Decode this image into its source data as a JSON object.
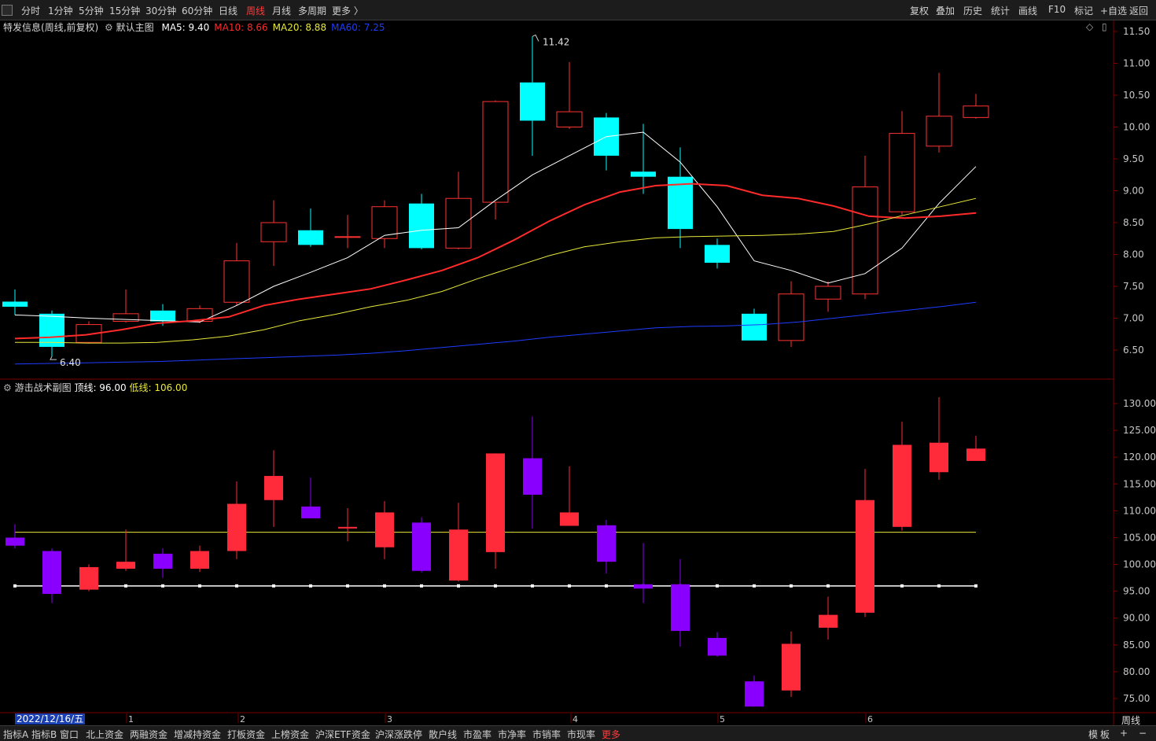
{
  "toolbar": {
    "periods": [
      "分时",
      "1分钟",
      "5分钟",
      "15分钟",
      "30分钟",
      "60分钟",
      "日线",
      "周线",
      "月线",
      "多周期",
      "更多 〉"
    ],
    "active_period": "周线",
    "right_items": [
      "复权",
      "叠加",
      "历史",
      "统计",
      "画线",
      "F10",
      "标记",
      "+自选",
      "返回"
    ]
  },
  "main_panel": {
    "stock_name": "特发信息",
    "period_info": "(周线,前复权)",
    "indicator_name": "默认主图",
    "ma": [
      {
        "label": "MA5: 9.40",
        "color": "#ffffff"
      },
      {
        "label": "MA10: 8.66",
        "color": "#ff2a2a"
      },
      {
        "label": "MA20: 8.88",
        "color": "#e8e83a"
      },
      {
        "label": "MA60: 7.25",
        "color": "#1e3cff"
      }
    ],
    "high_marker": "11.42",
    "low_marker": "6.40",
    "y_ticks": [
      "11.50",
      "11.00",
      "10.50",
      "10.00",
      "9.50",
      "9.00",
      "8.50",
      "8.00",
      "7.50",
      "7.00",
      "6.50"
    ]
  },
  "sub_panel": {
    "indicator_name": "游击战术副图",
    "top_line_label": "顶线: 96.00",
    "low_line_label": "低线: 106.00",
    "y_ticks": [
      "130.00",
      "125.00",
      "120.00",
      "115.00",
      "110.00",
      "105.00",
      "100.00",
      "95.00",
      "90.00",
      "85.00",
      "80.00",
      "75.00"
    ]
  },
  "x_axis": {
    "date_label": "2022/12/16/五",
    "month_labels": [
      "1",
      "2",
      "3",
      "4",
      "5",
      "6"
    ],
    "period_label": "周线"
  },
  "bottom_tabs": [
    "指标A",
    "指标B",
    "窗口",
    "北上资金",
    "两融资金",
    "增减持资金",
    "打板资金",
    "上榜资金",
    "沪深ETF资金",
    "沪深涨跌停",
    "散户线",
    "市盈率",
    "市净率",
    "市销率",
    "市现率",
    "更多"
  ],
  "bottom_active": "更多",
  "bottom_right": [
    "模",
    "板",
    "+",
    "−"
  ],
  "colors": {
    "up": "#ff3232",
    "down": "#00ffff",
    "sub_up": "#ff2a3a",
    "sub_down": "#8a00ff",
    "grid": "#7a0000"
  },
  "chart_data": [
    {
      "type": "candlestick",
      "title": "特发信息 (周线,前复权)",
      "ylim": [
        6.2,
        11.6
      ],
      "candles": [
        {
          "o": 7.26,
          "c": 7.18,
          "h": 7.45,
          "l": 7.05
        },
        {
          "o": 7.07,
          "c": 6.55,
          "h": 7.12,
          "l": 6.4
        },
        {
          "o": 6.62,
          "c": 6.9,
          "h": 6.95,
          "l": 6.6
        },
        {
          "o": 6.95,
          "c": 7.07,
          "h": 7.45,
          "l": 6.93
        },
        {
          "o": 7.12,
          "c": 6.95,
          "h": 7.22,
          "l": 6.88
        },
        {
          "o": 6.95,
          "c": 7.15,
          "h": 7.2,
          "l": 6.92
        },
        {
          "o": 7.25,
          "c": 7.9,
          "h": 8.18,
          "l": 7.2
        },
        {
          "o": 8.2,
          "c": 8.5,
          "h": 8.85,
          "l": 7.82
        },
        {
          "o": 8.38,
          "c": 8.15,
          "h": 8.72,
          "l": 8.12
        },
        {
          "o": 8.27,
          "c": 8.28,
          "h": 8.62,
          "l": 8.1
        },
        {
          "o": 8.25,
          "c": 8.75,
          "h": 8.85,
          "l": 8.1
        },
        {
          "o": 8.8,
          "c": 8.1,
          "h": 8.95,
          "l": 8.08
        },
        {
          "o": 8.1,
          "c": 8.88,
          "h": 9.3,
          "l": 8.08
        },
        {
          "o": 8.82,
          "c": 10.4,
          "h": 10.42,
          "l": 8.55
        },
        {
          "o": 10.7,
          "c": 10.1,
          "h": 11.42,
          "l": 9.55
        },
        {
          "o": 10.0,
          "c": 10.24,
          "h": 11.02,
          "l": 9.97
        },
        {
          "o": 10.15,
          "c": 9.55,
          "h": 10.22,
          "l": 9.32
        },
        {
          "o": 9.3,
          "c": 9.22,
          "h": 10.05,
          "l": 8.95
        },
        {
          "o": 9.22,
          "c": 8.4,
          "h": 9.68,
          "l": 8.1
        },
        {
          "o": 8.15,
          "c": 7.87,
          "h": 8.25,
          "l": 7.78
        },
        {
          "o": 7.07,
          "c": 6.65,
          "h": 7.15,
          "l": 6.65
        },
        {
          "o": 6.65,
          "c": 7.38,
          "h": 7.58,
          "l": 6.55
        },
        {
          "o": 7.3,
          "c": 7.5,
          "h": 7.58,
          "l": 7.1
        },
        {
          "o": 7.38,
          "c": 9.06,
          "h": 9.55,
          "l": 7.3
        },
        {
          "o": 8.67,
          "c": 9.9,
          "h": 10.25,
          "l": 8.62
        },
        {
          "o": 9.7,
          "c": 10.17,
          "h": 10.85,
          "l": 9.6
        },
        {
          "o": 10.15,
          "c": 10.33,
          "h": 10.52,
          "l": 10.13
        }
      ],
      "series": [
        {
          "name": "MA5",
          "values": [
            7.05,
            7.03,
            7.0,
            6.98,
            6.96,
            6.94,
            7.2,
            7.5,
            7.72,
            7.95,
            8.3,
            8.38,
            8.42,
            8.85,
            9.25,
            9.55,
            9.85,
            9.92,
            9.45,
            8.75,
            7.9,
            7.75,
            7.55,
            7.7,
            8.1,
            8.8,
            9.38
          ]
        },
        {
          "name": "MA10",
          "values": [
            6.68,
            6.7,
            6.74,
            6.82,
            6.92,
            6.96,
            7.02,
            7.2,
            7.3,
            7.38,
            7.46,
            7.6,
            7.75,
            7.95,
            8.22,
            8.52,
            8.78,
            8.98,
            9.08,
            9.11,
            9.08,
            8.93,
            8.88,
            8.76,
            8.6,
            8.57,
            8.6,
            8.65
          ]
        },
        {
          "name": "MA20",
          "values": [
            6.62,
            6.62,
            6.61,
            6.61,
            6.62,
            6.66,
            6.72,
            6.82,
            6.96,
            7.06,
            7.18,
            7.28,
            7.42,
            7.62,
            7.8,
            7.98,
            8.12,
            8.2,
            8.26,
            8.28,
            8.29,
            8.3,
            8.32,
            8.36,
            8.48,
            8.62,
            8.75,
            8.88
          ]
        },
        {
          "name": "MA60",
          "values": [
            6.28,
            6.29,
            6.3,
            6.31,
            6.32,
            6.34,
            6.36,
            6.38,
            6.4,
            6.42,
            6.45,
            6.49,
            6.54,
            6.59,
            6.64,
            6.7,
            6.75,
            6.8,
            6.85,
            6.87,
            6.88,
            6.9,
            6.94,
            7.0,
            7.06,
            7.12,
            7.18,
            7.25
          ]
        }
      ]
    },
    {
      "type": "candlestick",
      "title": "游击战术副图",
      "ylim": [
        73,
        133
      ],
      "top_line": 96,
      "low_line": 106,
      "candles": [
        {
          "o": 105,
          "c": 103.5,
          "h": 107.5,
          "l": 103
        },
        {
          "o": 102.5,
          "c": 94.5,
          "h": 103,
          "l": 92.8
        },
        {
          "o": 95.3,
          "c": 99.5,
          "h": 100,
          "l": 95
        },
        {
          "o": 99.2,
          "c": 100.5,
          "h": 106.5,
          "l": 98.8
        },
        {
          "o": 102,
          "c": 99.2,
          "h": 103,
          "l": 97.5
        },
        {
          "o": 99.2,
          "c": 102.5,
          "h": 103.5,
          "l": 98.6
        },
        {
          "o": 102.5,
          "c": 111.3,
          "h": 115.5,
          "l": 101
        },
        {
          "o": 112,
          "c": 116.5,
          "h": 121.3,
          "l": 107
        },
        {
          "o": 110.8,
          "c": 108.6,
          "h": 116.2,
          "l": 108.6
        },
        {
          "o": 106.8,
          "c": 107,
          "h": 110.5,
          "l": 104.3
        },
        {
          "o": 103.2,
          "c": 109.7,
          "h": 111.8,
          "l": 101
        },
        {
          "o": 107.8,
          "c": 98.8,
          "h": 108.8,
          "l": 98.5
        },
        {
          "o": 97,
          "c": 106.5,
          "h": 111.5,
          "l": 96.8
        },
        {
          "o": 102.3,
          "c": 120.7,
          "h": 120.7,
          "l": 99.2
        },
        {
          "o": 119.8,
          "c": 113,
          "h": 127.6,
          "l": 106.7
        },
        {
          "o": 107.2,
          "c": 109.7,
          "h": 118.3,
          "l": 107.2
        },
        {
          "o": 107.3,
          "c": 100.5,
          "h": 108.3,
          "l": 98.3
        },
        {
          "o": 96.3,
          "c": 95.5,
          "h": 104,
          "l": 92.8
        },
        {
          "o": 96.3,
          "c": 87.6,
          "h": 101,
          "l": 84.7
        },
        {
          "o": 86.3,
          "c": 83,
          "h": 87.4,
          "l": 82.8
        },
        {
          "o": 78.2,
          "c": 73.5,
          "h": 79.3,
          "l": 73.5
        },
        {
          "o": 76.5,
          "c": 85.2,
          "h": 87.5,
          "l": 75.3
        },
        {
          "o": 88.2,
          "c": 90.6,
          "h": 94,
          "l": 86
        },
        {
          "o": 91,
          "c": 112,
          "h": 117.8,
          "l": 90.2
        },
        {
          "o": 107,
          "c": 122.3,
          "h": 126.6,
          "l": 106.3
        },
        {
          "o": 117.2,
          "c": 122.7,
          "h": 131.2,
          "l": 115.8
        },
        {
          "o": 119.3,
          "c": 121.6,
          "h": 124,
          "l": 119.3
        }
      ]
    }
  ]
}
